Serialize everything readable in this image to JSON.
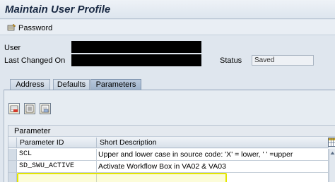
{
  "window": {
    "title": "Maintain User Profile"
  },
  "toolbar": {
    "password_label": "Password"
  },
  "header": {
    "user_label": "User",
    "last_changed_label": "Last Changed On",
    "status_label": "Status",
    "status_value": "Saved"
  },
  "tabs": [
    {
      "label": "Address",
      "active": false
    },
    {
      "label": "Defaults",
      "active": false
    },
    {
      "label": "Parameters",
      "active": true
    }
  ],
  "table": {
    "title": "Parameter",
    "columns": [
      "Parameter ID",
      "Short Description"
    ],
    "rows": [
      {
        "id": "SCL",
        "description": "Upper and lower case in source code: 'X' = lower, ' ' =upper"
      },
      {
        "id": "SD_SWU_ACTIVE",
        "description": "Activate Workflow Box in VA02 & VA03",
        "highlighted": true
      },
      {
        "id": "",
        "description": ""
      }
    ]
  },
  "colors": {
    "highlight": "#e3e600",
    "active_tab": "#9fb3cb",
    "background": "#dfe6ee"
  }
}
